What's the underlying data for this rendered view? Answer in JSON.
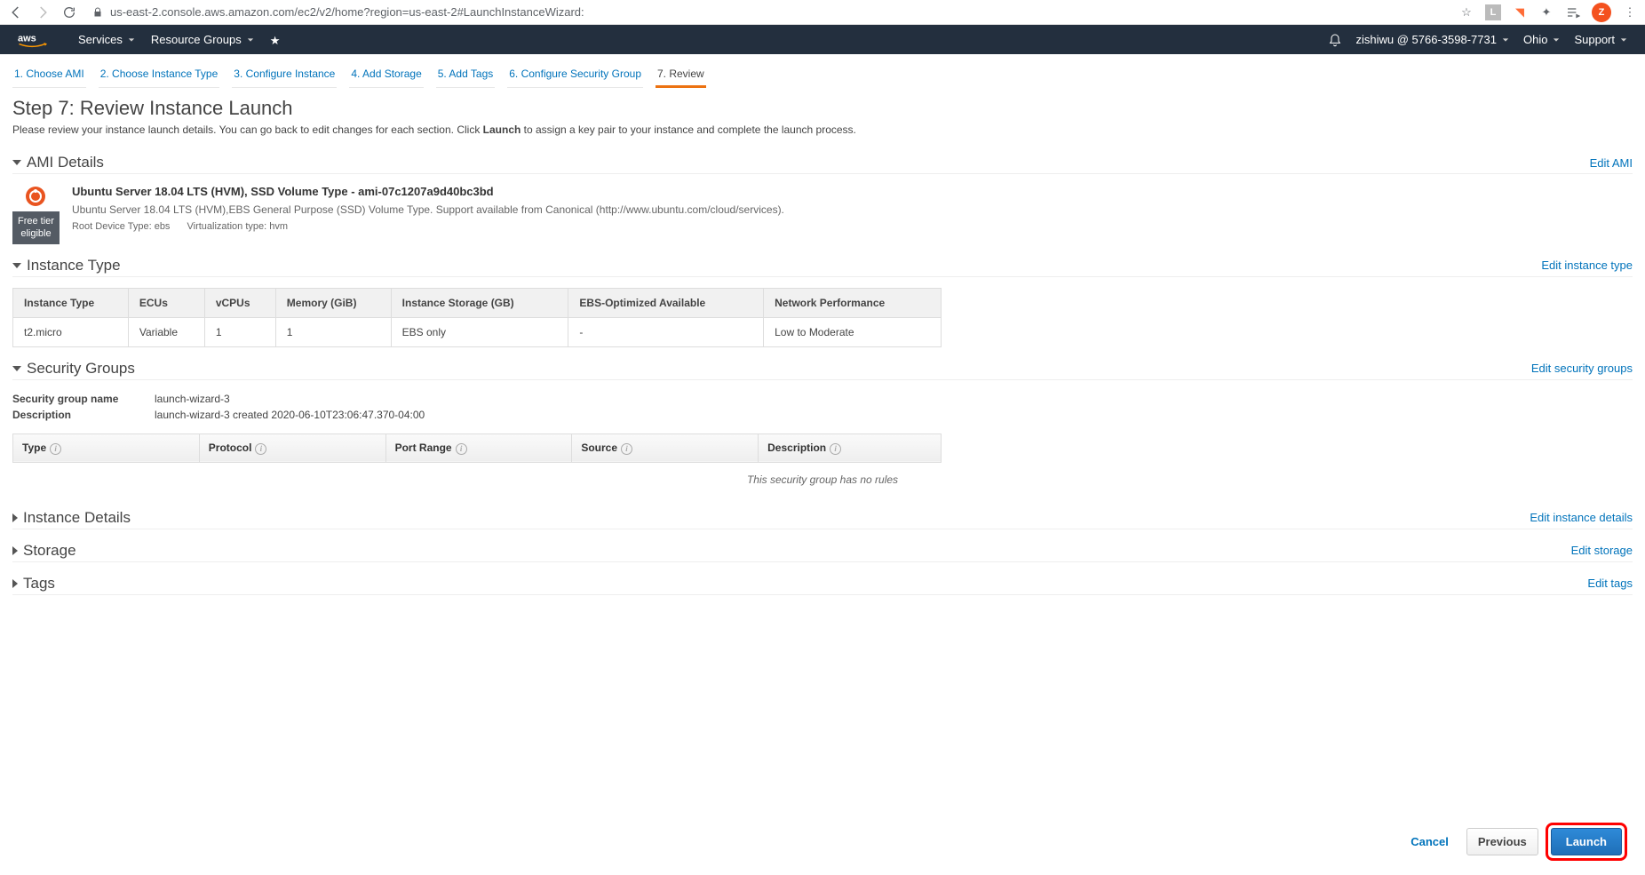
{
  "browser": {
    "url": "us-east-2.console.aws.amazon.com/ec2/v2/home?region=us-east-2#LaunchInstanceWizard:",
    "avatar_letter": "Z",
    "ext1": "L"
  },
  "topbar": {
    "services": "Services",
    "resource_groups": "Resource Groups",
    "user": "zishiwu @ 5766-3598-7731",
    "region": "Ohio",
    "support": "Support"
  },
  "wizard_tabs": [
    "1. Choose AMI",
    "2. Choose Instance Type",
    "3. Configure Instance",
    "4. Add Storage",
    "5. Add Tags",
    "6. Configure Security Group",
    "7. Review"
  ],
  "page": {
    "title": "Step 7: Review Instance Launch",
    "desc_a": "Please review your instance launch details. You can go back to edit changes for each section. Click ",
    "desc_b": "Launch",
    "desc_c": " to assign a key pair to your instance and complete the launch process."
  },
  "ami_section": {
    "title": "AMI Details",
    "edit": "Edit AMI",
    "free_tier_a": "Free tier",
    "free_tier_b": "eligible",
    "name": "Ubuntu Server 18.04 LTS (HVM), SSD Volume Type - ami-07c1207a9d40bc3bd",
    "desc": "Ubuntu Server 18.04 LTS (HVM),EBS General Purpose (SSD) Volume Type. Support available from Canonical (http://www.ubuntu.com/cloud/services).",
    "root": "Root Device Type: ebs",
    "virt": "Virtualization type: hvm"
  },
  "instance_section": {
    "title": "Instance Type",
    "edit": "Edit instance type",
    "headers": [
      "Instance Type",
      "ECUs",
      "vCPUs",
      "Memory (GiB)",
      "Instance Storage (GB)",
      "EBS-Optimized Available",
      "Network Performance"
    ],
    "row": [
      "t2.micro",
      "Variable",
      "1",
      "1",
      "EBS only",
      "-",
      "Low to Moderate"
    ]
  },
  "sg_section": {
    "title": "Security Groups",
    "edit": "Edit security groups",
    "name_label": "Security group name",
    "name_val": "launch-wizard-3",
    "desc_label": "Description",
    "desc_val": "launch-wizard-3 created 2020-06-10T23:06:47.370-04:00",
    "cols": [
      "Type",
      "Protocol",
      "Port Range",
      "Source",
      "Description"
    ],
    "no_rules": "This security group has no rules"
  },
  "collapsed": {
    "details_title": "Instance Details",
    "details_edit": "Edit instance details",
    "storage_title": "Storage",
    "storage_edit": "Edit storage",
    "tags_title": "Tags",
    "tags_edit": "Edit tags"
  },
  "footer": {
    "cancel": "Cancel",
    "prev": "Previous",
    "launch": "Launch"
  }
}
